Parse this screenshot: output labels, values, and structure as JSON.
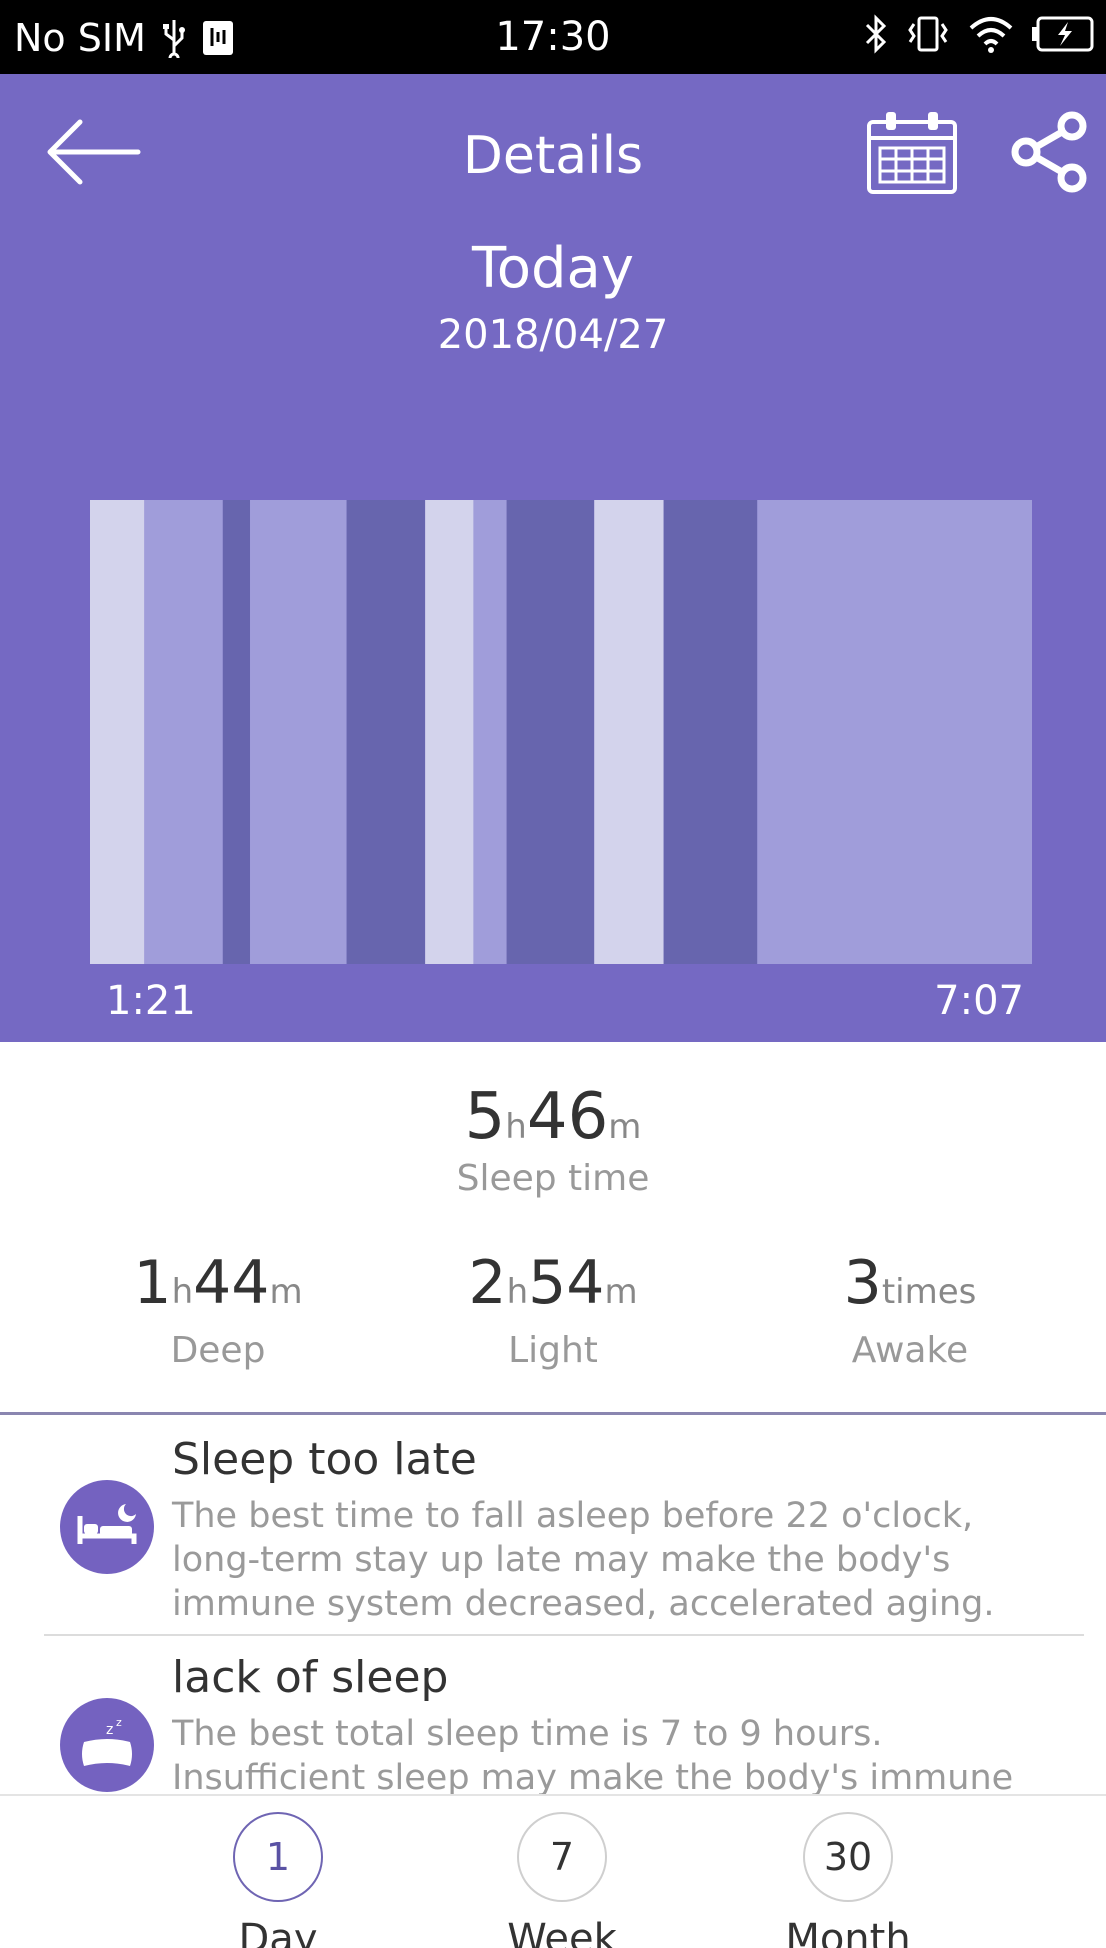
{
  "status_bar": {
    "carrier": "No SIM",
    "time": "17:30"
  },
  "header": {
    "title": "Details",
    "day": "Today",
    "date": "2018/04/27"
  },
  "chart_data": {
    "type": "timeline",
    "start_label": "1:21",
    "end_label": "7:07",
    "stage_colors": {
      "awake": "#d3d3ec",
      "light": "#a09dda",
      "deep": "#6765ae"
    },
    "segments": [
      {
        "stage": "awake",
        "duration_min": 18
      },
      {
        "stage": "light",
        "duration_min": 26
      },
      {
        "stage": "deep",
        "duration_min": 9
      },
      {
        "stage": "light",
        "duration_min": 32
      },
      {
        "stage": "deep",
        "duration_min": 26
      },
      {
        "stage": "awake",
        "duration_min": 16
      },
      {
        "stage": "light",
        "duration_min": 11
      },
      {
        "stage": "deep",
        "duration_min": 29
      },
      {
        "stage": "awake",
        "duration_min": 23
      },
      {
        "stage": "deep",
        "duration_min": 31
      },
      {
        "stage": "light",
        "duration_min": 91
      }
    ]
  },
  "summary": {
    "total": {
      "hours": "5",
      "h_unit": "h",
      "minutes": "46",
      "m_unit": "m",
      "label": "Sleep time"
    },
    "deep": {
      "hours": "1",
      "h_unit": "h",
      "minutes": "44",
      "m_unit": "m",
      "label": "Deep"
    },
    "light": {
      "hours": "2",
      "h_unit": "h",
      "minutes": "54",
      "m_unit": "m",
      "label": "Light"
    },
    "awake": {
      "count": "3",
      "unit": "times",
      "label": "Awake"
    }
  },
  "tips": [
    {
      "title": "Sleep too late",
      "body": "The best time to fall asleep before 22 o'clock, long-term stay up late may make the body's immune system decreased, accelerated aging."
    },
    {
      "title": "lack of sleep",
      "body": "The best total sleep time is 7 to 9 hours. Insufficient sleep may make the body's immune"
    }
  ],
  "periods": [
    {
      "num": "1",
      "label": "Day"
    },
    {
      "num": "7",
      "label": "Week"
    },
    {
      "num": "30",
      "label": "Month"
    }
  ],
  "icons": {
    "back": "arrow-left-icon",
    "calendar": "calendar-icon",
    "share": "share-icon",
    "bed": "bed-moon-icon",
    "pillow": "pillow-zzz-icon"
  },
  "colors": {
    "header_bg": "#7569c3",
    "accent": "#7462c0"
  }
}
